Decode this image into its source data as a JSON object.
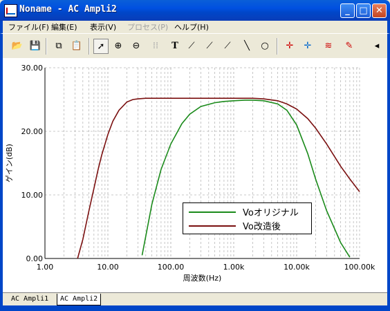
{
  "window": {
    "title": "Noname - AC Ampli2"
  },
  "menu": [
    {
      "label": "ファイル(F)",
      "enabled": true
    },
    {
      "label": "編集(E)",
      "enabled": true
    },
    {
      "label": "表示(V)",
      "enabled": true
    },
    {
      "label": "プロセス(P)",
      "enabled": false
    },
    {
      "label": "ヘルプ(H)",
      "enabled": true
    }
  ],
  "toolbar": [
    "open-icon",
    "save-icon",
    "copy-icon",
    "paste-icon",
    "pointer-icon",
    "zoom-in-icon",
    "zoom-100-icon",
    "grid-icon",
    "text-icon",
    "label-icon",
    "label2-icon",
    "label3-icon",
    "line-icon",
    "circle-icon",
    "cursor-a-icon",
    "cursor-b-icon",
    "multi-trace-icon",
    "pick-icon"
  ],
  "tabs": [
    "AC Ampli1",
    "AC Ampli2"
  ],
  "active_tab": 1,
  "colors": {
    "green": "#1a8a1a",
    "darkred": "#7a0f0f",
    "titlebar": "#0050e0"
  },
  "chart_data": {
    "type": "line",
    "title": "",
    "xlabel": "周波数(Hz)",
    "ylabel": "ゲイン(dB)",
    "xscale": "log",
    "xlim": [
      1,
      100000
    ],
    "ylim": [
      0,
      30
    ],
    "xticks": [
      "1.00",
      "10.00",
      "100.00",
      "1.00k",
      "10.00k",
      "100.00k"
    ],
    "yticks": [
      "0.00",
      "10.00",
      "20.00",
      "30.00"
    ],
    "grid": true,
    "legend_placement": "bottom-center",
    "series": [
      {
        "name": "Voオリジナル",
        "color": "#1a8a1a",
        "x": [
          35,
          40,
          50,
          70,
          100,
          150,
          200,
          300,
          500,
          700,
          1000,
          1500,
          2000,
          3000,
          5000,
          7000,
          10000,
          15000,
          20000,
          30000,
          50000,
          70000
        ],
        "y": [
          0.5,
          3.5,
          8.5,
          14.0,
          18.0,
          21.2,
          22.7,
          23.9,
          24.5,
          24.7,
          24.8,
          24.9,
          24.9,
          24.8,
          24.3,
          23.3,
          21.0,
          16.5,
          12.5,
          7.5,
          2.5,
          0.2
        ]
      },
      {
        "name": "Vo改造後",
        "color": "#7a0f0f",
        "x": [
          3.3,
          4,
          5,
          6,
          7,
          8,
          10,
          12,
          15,
          20,
          25,
          30,
          40,
          50,
          100,
          1000,
          2000,
          3000,
          5000,
          7000,
          10000,
          15000,
          20000,
          30000,
          50000,
          70000,
          100000
        ],
        "y": [
          0.0,
          3.0,
          7.5,
          11.0,
          14.0,
          16.3,
          19.5,
          21.6,
          23.3,
          24.6,
          25.0,
          25.1,
          25.2,
          25.2,
          25.2,
          25.2,
          25.2,
          25.1,
          24.8,
          24.3,
          23.5,
          22.0,
          20.5,
          18.0,
          14.5,
          12.5,
          10.5
        ]
      }
    ]
  }
}
